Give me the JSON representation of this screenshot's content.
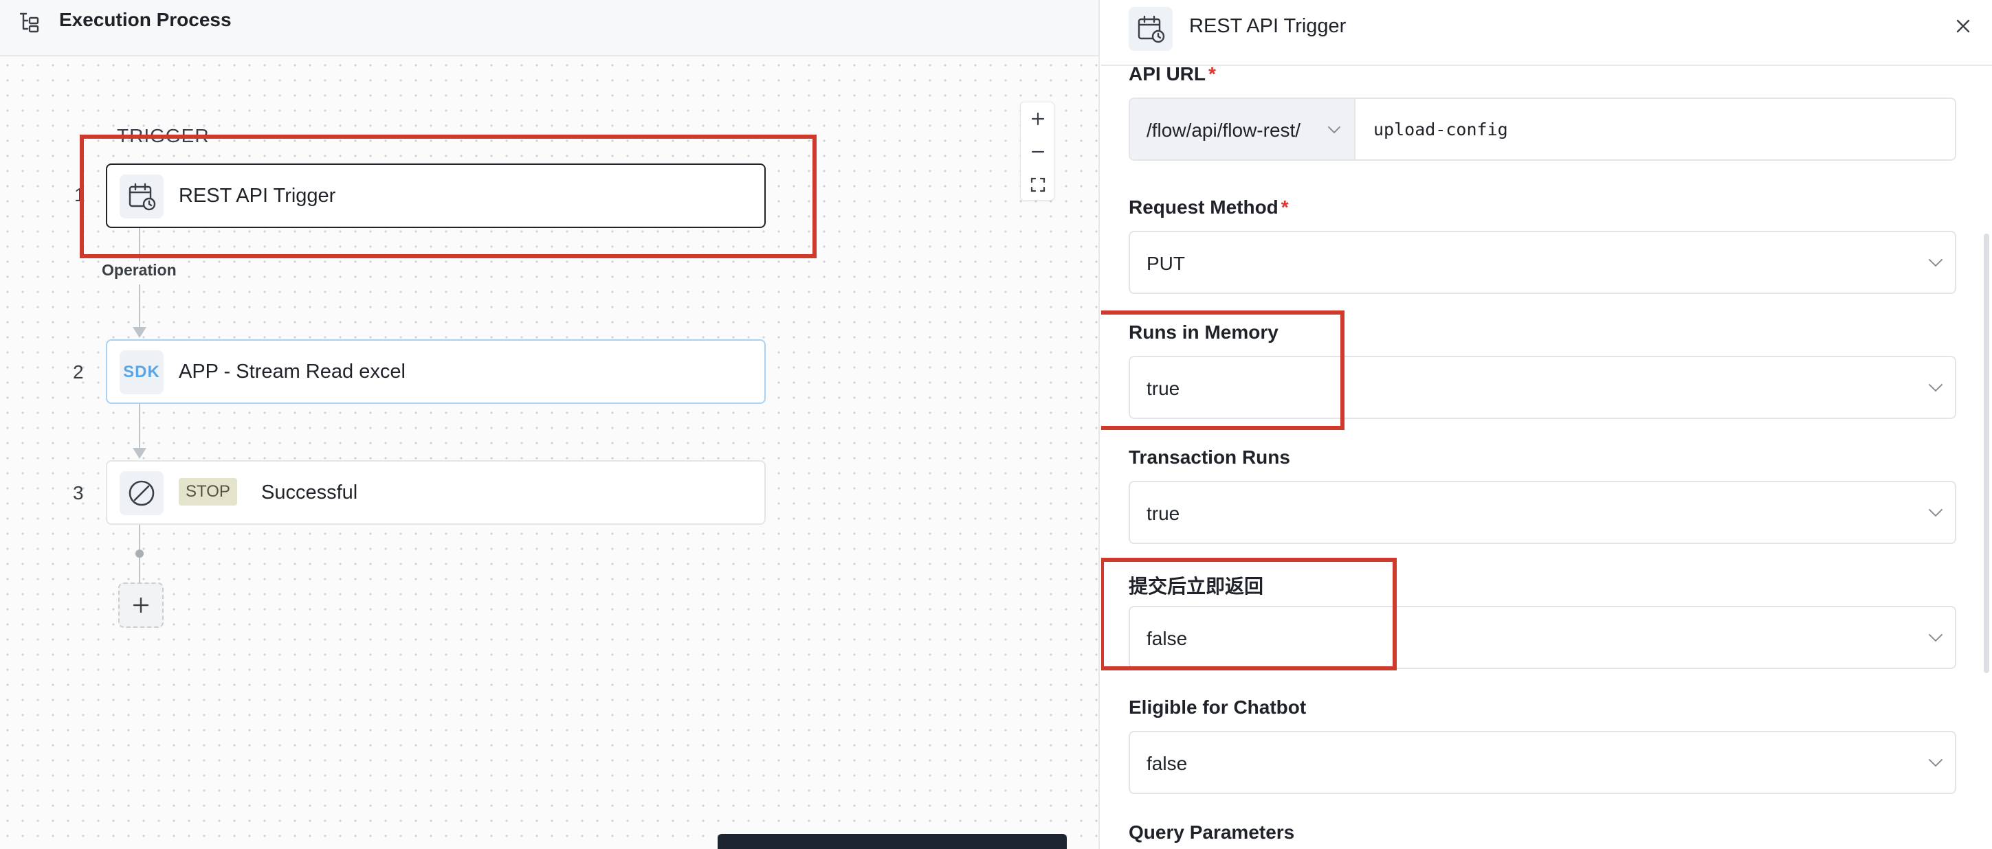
{
  "left": {
    "title": "Execution Process",
    "trigger_section_label": "TRIGGER",
    "nodes": [
      {
        "number": "1",
        "label": "REST API Trigger",
        "icon": "calendar-clock-icon"
      },
      {
        "number": "2",
        "label": "APP - Stream Read excel",
        "icon_text": "SDK"
      },
      {
        "number": "3",
        "label": "Successful",
        "tag": "STOP",
        "icon": "stop-circle-icon"
      }
    ],
    "connector_label": "Operation",
    "zoom": {
      "in": "+",
      "out": "−"
    },
    "add_step": "+"
  },
  "panel": {
    "title": "REST API Trigger",
    "fields": {
      "api_url": {
        "label": "API URL",
        "required": "*",
        "prefix": "/flow/api/flow-rest/",
        "value": "upload-config"
      },
      "request_method": {
        "label": "Request Method",
        "required": "*",
        "value": "PUT"
      },
      "runs_in_memory": {
        "label": "Runs in Memory",
        "value": "true"
      },
      "transaction_runs": {
        "label": "Transaction Runs",
        "value": "true"
      },
      "return_immediately": {
        "label": "提交后立即返回",
        "value": "false"
      },
      "eligible_chatbot": {
        "label": "Eligible for Chatbot",
        "value": "false"
      },
      "query_parameters": {
        "label": "Query Parameters"
      }
    }
  },
  "colors": {
    "highlight": "#cf3a2c",
    "required": "#e0362c",
    "sdk": "#58a6e8",
    "stop_tag_bg": "#e4e3cc"
  }
}
